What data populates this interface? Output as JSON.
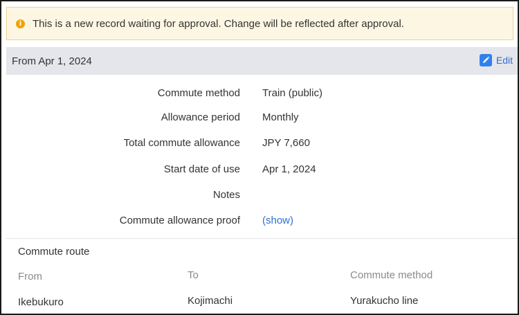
{
  "notice": {
    "icon": "info-icon",
    "text": "This is a new record waiting for approval. Change will be reflected after approval."
  },
  "period": {
    "title": "From Apr 1, 2024",
    "edit_label": "Edit",
    "edit_icon": "pencil-icon"
  },
  "details": [
    {
      "label": "Commute method",
      "value": "Train (public)"
    },
    {
      "label": "Allowance period",
      "value": "Monthly"
    },
    {
      "label": "Total commute allowance",
      "value": "JPY 7,660"
    },
    {
      "label": "Start date of use",
      "value": "Apr 1, 2024"
    },
    {
      "label": "Notes",
      "value": ""
    },
    {
      "label": "Commute allowance proof",
      "value": "(show)"
    }
  ],
  "route": {
    "title": "Commute route",
    "columns": [
      "From",
      "To",
      "Commute method"
    ],
    "rows": [
      [
        "Ikebukuro",
        "Kojimachi",
        "Yurakucho line"
      ]
    ]
  },
  "colors": {
    "notice_bg": "#fdf6e3",
    "notice_border": "#f0d48a",
    "info_icon": "#f0a400",
    "header_bg": "#e4e6eb",
    "link": "#2f6fd6",
    "edit_icon_bg": "#2f80ed"
  }
}
